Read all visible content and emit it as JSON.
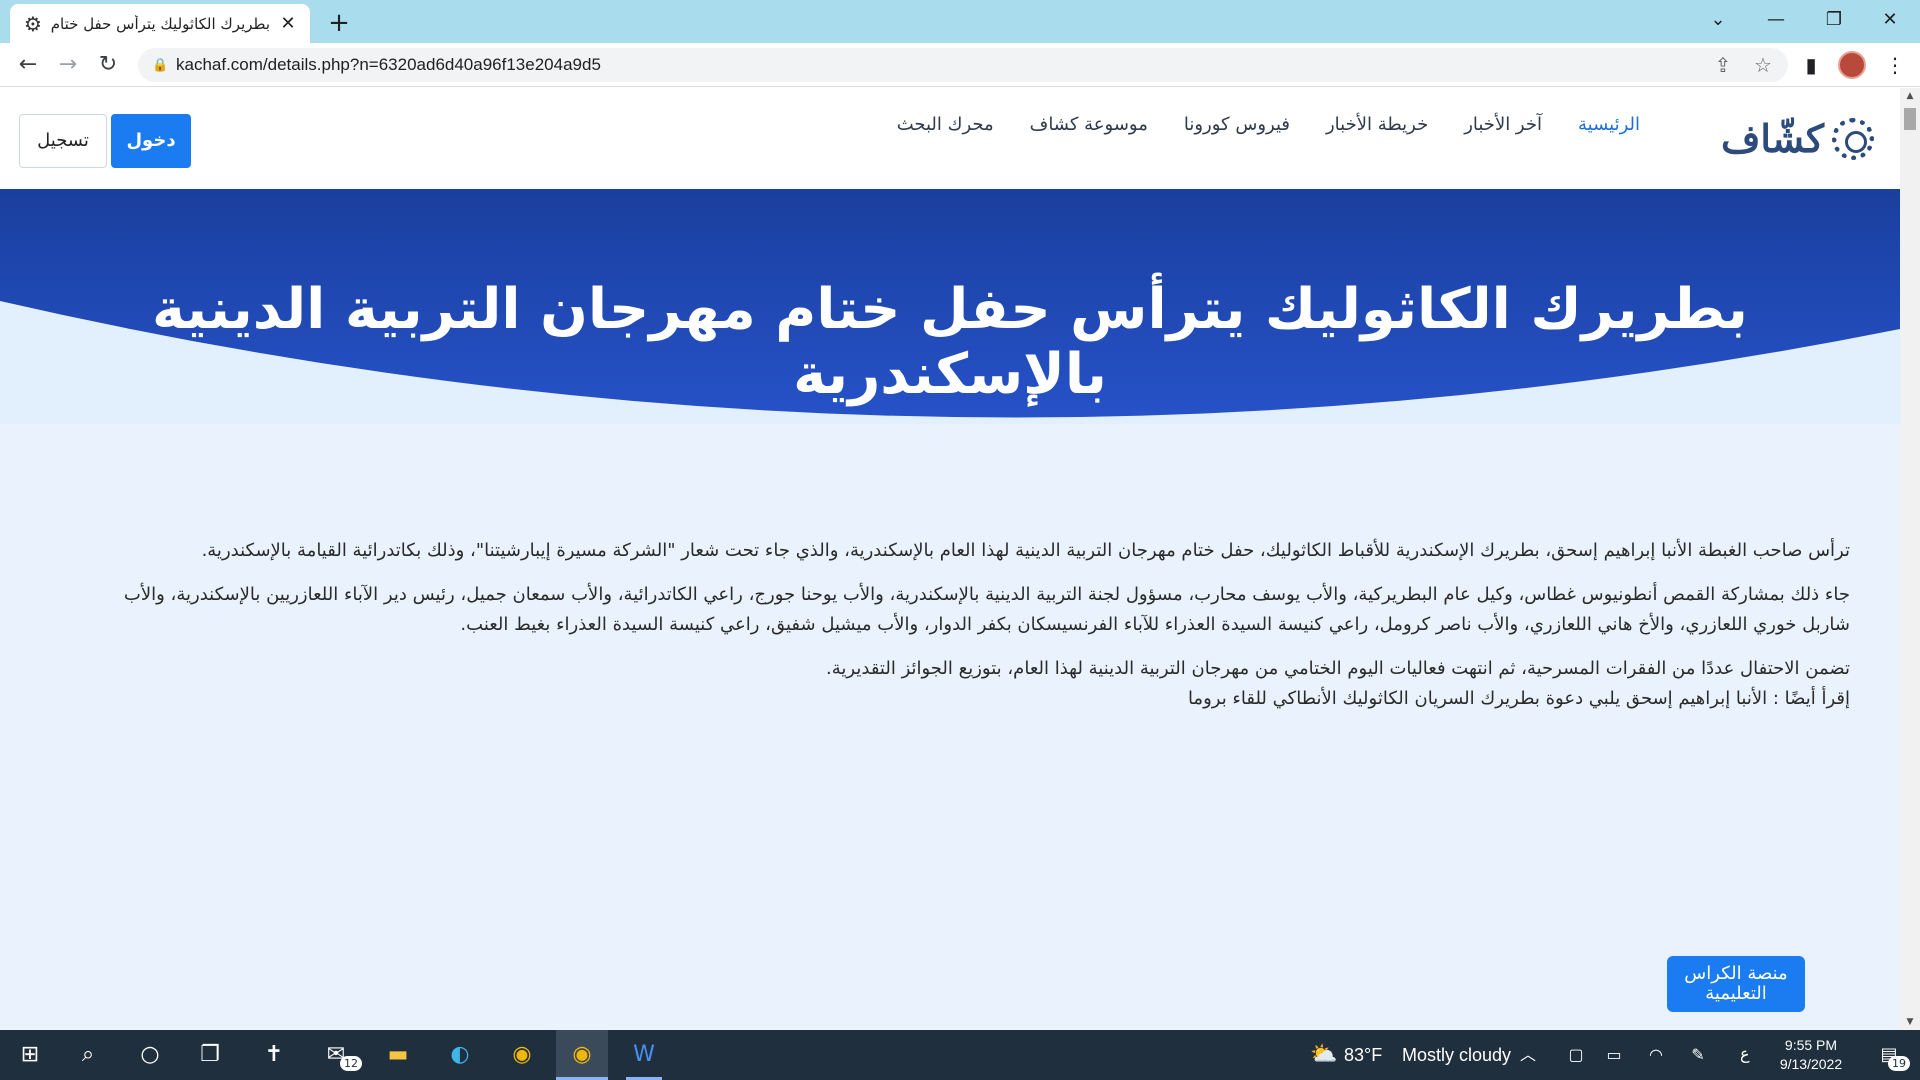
{
  "browser": {
    "tab_title": "بطريرك الكاثوليك يترأس حفل ختام",
    "favicon": "gear-logo-icon",
    "new_tab": "+",
    "close_tab": "✕",
    "url": "kachaf.com/details.php?n=6320ad6d40a96f13e204a9d5",
    "window_controls": {
      "dropdown": "⌄",
      "minimize": "—",
      "maximize": "❐",
      "close": "✕"
    }
  },
  "site": {
    "logo_text": "كشّاف",
    "nav": [
      {
        "label": "الرئيسية",
        "active": true
      },
      {
        "label": "آخر الأخبار"
      },
      {
        "label": "خريطة الأخبار"
      },
      {
        "label": "فيروس كورونا"
      },
      {
        "label": "موسوعة كشاف"
      },
      {
        "label": "محرك البحث"
      }
    ],
    "login_label": "دخول",
    "register_label": "تسجيل"
  },
  "hero": {
    "title": "بطريرك الكاثوليك يترأس حفل ختام مهرجان التربية الدينية بالإسكندرية",
    "colors": {
      "dark": "#1a3f9e",
      "light": "#2e5fd6",
      "bg": "#e2effc"
    }
  },
  "article": {
    "paragraphs": [
      "ترأس صاحب الغبطة الأنبا إبراهيم إسحق، بطريرك الإسكندرية للأقباط الكاثوليك، حفل ختام مهرجان التربية الدينية لهذا العام بالإسكندرية، والذي جاء تحت شعار \"الشركة مسيرة إيبارشيتنا\"، وذلك بكاتدرائية القيامة بالإسكندرية.",
      "جاء ذلك بمشاركة القمص أنطونيوس غطاس، وكيل عام البطريركية، والأب يوسف محارب، مسؤول لجنة التربية الدينية بالإسكندرية، والأب يوحنا جورج، راعي الكاتدرائية، والأب سمعان جميل، رئيس دير الآباء اللعازريين بالإسكندرية، والأب شاربل خوري اللعازري، والأخ هاني اللعازري، والأب ناصر كرومل، راعي كنيسة السيدة العذراء للآباء الفرنسيسكان بكفر الدوار، والأب ميشيل شفيق، راعي كنيسة السيدة العذراء بغيط العنب.",
      "تضمن الاحتفال عددًا من الفقرات المسرحية، ثم انتهت فعاليات اليوم الختامي من مهرجان التربية الدينية لهذا العام، بتوزيع الجوائز التقديرية.",
      "إقرأ أيضًا : الأنبا إبراهيم إسحق يلبي دعوة بطريرك السريان الكاثوليك الأنطاكي للقاء بروما"
    ]
  },
  "edu_button": {
    "line1": "منصة الكراس",
    "line2": "التعليمية"
  },
  "taskbar": {
    "weather_temp": "83°F",
    "weather_text": "Mostly cloudy",
    "lang": "ع",
    "time": "9:55 PM",
    "date": "9/13/2022",
    "mail_badge": "12",
    "notif_badge": "19"
  }
}
